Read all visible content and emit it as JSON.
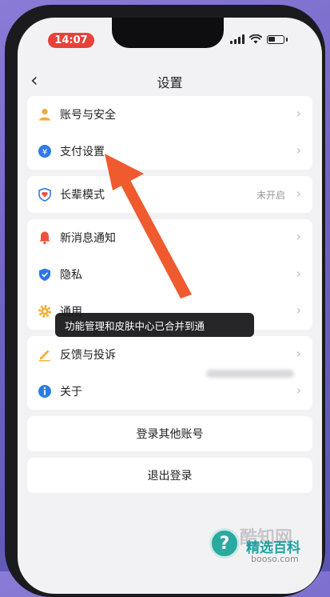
{
  "status_bar": {
    "time": "14:07"
  },
  "nav": {
    "back_glyph": "‹",
    "title": "设置"
  },
  "settings": {
    "account_security": "账号与安全",
    "payment": "支付设置",
    "elder_mode": "长辈模式",
    "elder_mode_value": "未开启",
    "notifications": "新消息通知",
    "privacy": "隐私",
    "general": "通用",
    "feedback": "反馈与投诉",
    "about": "关于"
  },
  "toast": {
    "text": "功能管理和皮肤中心已合并到通"
  },
  "buttons": {
    "login_other": "登录其他账号",
    "logout": "退出登录"
  },
  "watermark": {
    "brand": "精选百科",
    "url": "booso.com",
    "bg_text": "酷知网"
  },
  "colors": {
    "accent_orange": "#ef5a2f",
    "account_icon": "#f2a93b",
    "payment_icon": "#2e7be6",
    "notify_icon": "#ef4f3c",
    "privacy_icon": "#2f75e8",
    "general_icon": "#f2b13a"
  },
  "icons": [
    "user-icon",
    "payment-icon",
    "heart-shield-icon",
    "bell-icon",
    "privacy-shield-icon",
    "gear-icon",
    "pencil-icon",
    "info-icon",
    "chevron-right-icon",
    "back-icon"
  ]
}
